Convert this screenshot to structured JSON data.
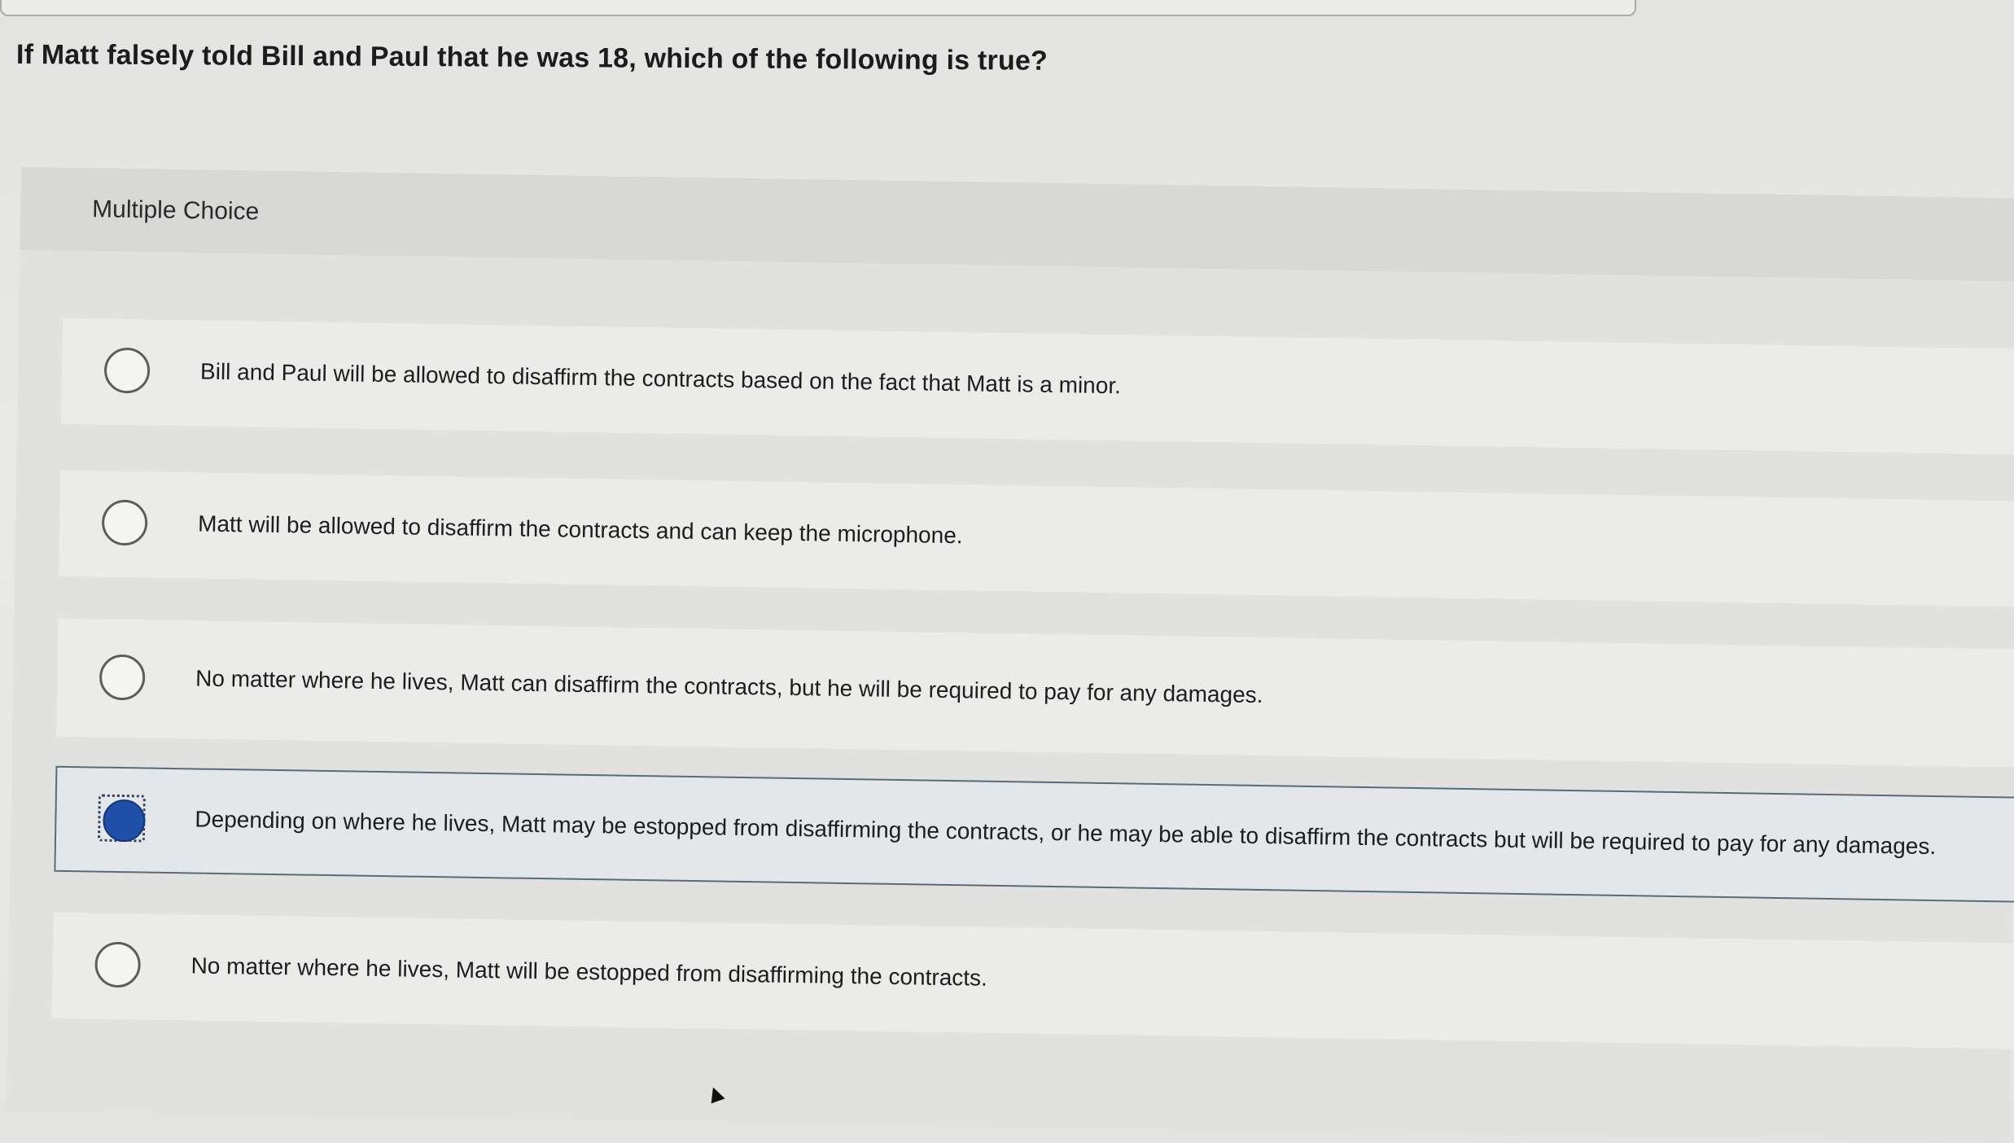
{
  "question": {
    "text": "If Matt falsely told Bill and Paul that he was 18, which of the following is true?"
  },
  "multiple_choice": {
    "label": "Multiple Choice",
    "selected_index": 3,
    "options": [
      {
        "text": "Bill and Paul will be allowed to disaffirm the contracts based on the fact that Matt is a minor.",
        "selected": false
      },
      {
        "text": "Matt will be allowed to disaffirm the contracts and can keep the microphone.",
        "selected": false
      },
      {
        "text": "No matter where he lives, Matt can disaffirm the contracts, but he will be required to pay for any damages.",
        "selected": false
      },
      {
        "text": "Depending on where he lives, Matt may be estopped from disaffirming the contracts, or he may be able to disaffirm the contracts but will be required to pay for any damages.",
        "selected": true
      },
      {
        "text": "No matter where he lives, Matt will be estopped from disaffirming the contracts.",
        "selected": false
      }
    ]
  },
  "colors": {
    "selected_radio_fill": "#1f4fa6",
    "selected_option_border": "#5b6a78",
    "page_background": "#e6e7e5"
  }
}
